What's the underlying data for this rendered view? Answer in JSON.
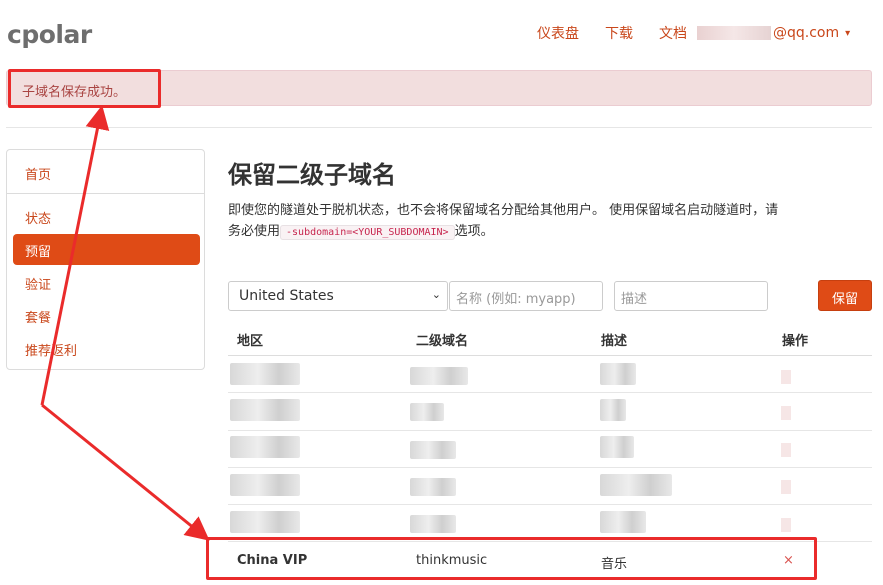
{
  "header": {
    "logo": "cpolar",
    "nav": [
      "仪表盘",
      "下载",
      "文档"
    ],
    "user_email_suffix": "@qq.com",
    "caret": "▾"
  },
  "alert": {
    "message": "子域名保存成功。"
  },
  "sidebar": {
    "items": [
      {
        "label": "首页",
        "active": false
      },
      {
        "label": "状态",
        "active": false
      },
      {
        "label": "预留",
        "active": true
      },
      {
        "label": "验证",
        "active": false
      },
      {
        "label": "套餐",
        "active": false
      },
      {
        "label": "推荐返利",
        "active": false
      }
    ]
  },
  "main": {
    "title": "保留二级子域名",
    "description_part1": "即使您的隧道处于脱机状态，也不会将保留域名分配给其他用户。 使用保留域名启动隧道时，请务必使用",
    "code": "-subdomain=<YOUR_SUBDOMAIN>",
    "description_part2": "选项。"
  },
  "form": {
    "region_selected": "United States",
    "name_placeholder": "名称 (例如: myapp)",
    "desc_placeholder": "描述",
    "save_label": "保留"
  },
  "table": {
    "headers": [
      "地区",
      "二级域名",
      "描述",
      "操作"
    ],
    "highlight_row": {
      "region": "China VIP",
      "subdomain": "thinkmusic",
      "description": "音乐",
      "action": "×"
    }
  },
  "colors": {
    "accent": "#df4b16",
    "link": "#c9471b",
    "alert_bg": "#f2dede",
    "alert_text": "#a94442",
    "annotation_red": "#ea2b2b"
  }
}
